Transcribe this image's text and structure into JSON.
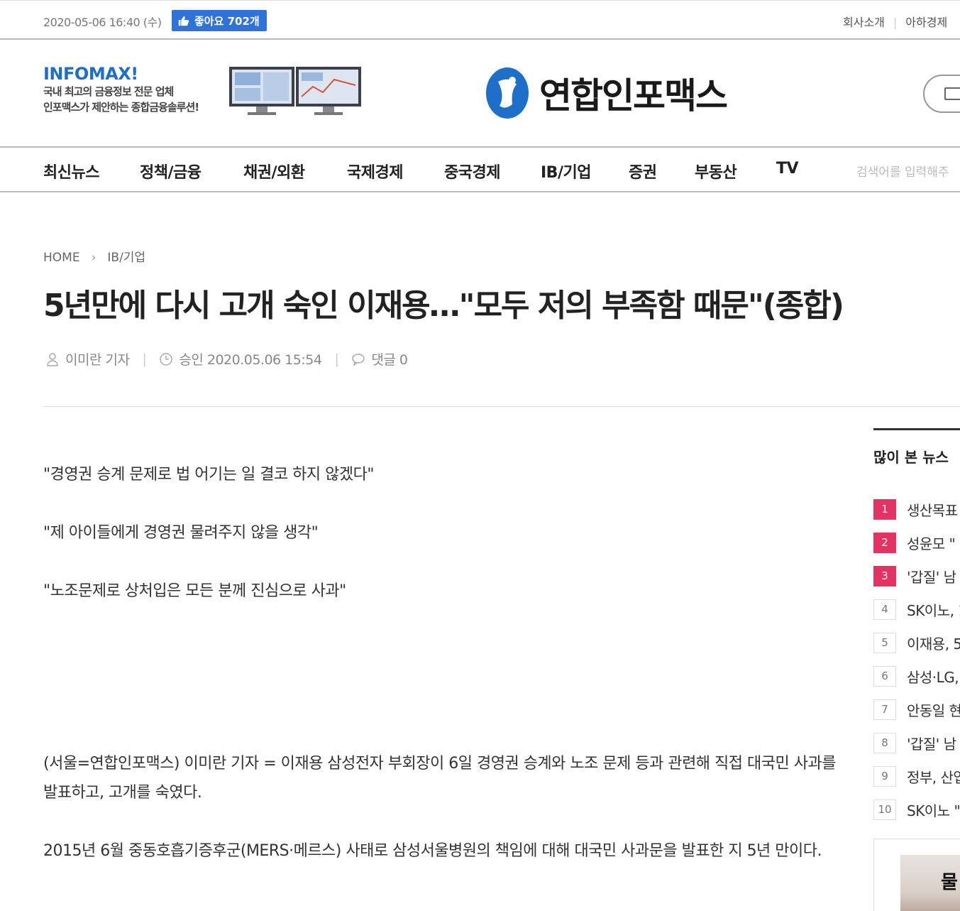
{
  "topbar": {
    "datetime": "2020-05-06 16:40 (수)",
    "like_label": "좋아요 702개",
    "links": [
      "회사소개",
      "아하경제"
    ]
  },
  "ad": {
    "brand": "INFOMAX!",
    "line1": "국내 최고의 금융정보 전문 업체",
    "line2": "인포맥스가 제안하는 종합금융솔루션!"
  },
  "logo": {
    "text": "연합인포맥스"
  },
  "nav": {
    "items": [
      "최신뉴스",
      "정책/금융",
      "채권/외환",
      "국제경제",
      "중국경제",
      "IB/기업",
      "증권",
      "부동산",
      "TV"
    ],
    "search_placeholder": "검색어를 입력해주"
  },
  "article": {
    "breadcrumb": [
      "HOME",
      "IB/기업"
    ],
    "title": "5년만에 다시 고개 숙인 이재용…\"모두 저의 부족함 때문\"(종합)",
    "author": "이미란 기자",
    "approved": "승인 2020.05.06 15:54",
    "comments": "댓글 0",
    "quotes": [
      "\"경영권 승계 문제로 법 어기는 일 결코 하지 않겠다\"",
      "\"제 아이들에게 경영권 물려주지 않을 생각\"",
      "\"노조문제로 상처입은 모든 분께 진심으로 사과\""
    ],
    "paragraphs": [
      "(서울=연합인포맥스) 이미란 기자 = 이재용 삼성전자 부회장이 6일 경영권 승계와 노조 문제 등과 관련해 직접 대국민 사과를 발표하고, 고개를 숙였다.",
      "2015년 6월 중동호흡기증후군(MERS·메르스) 사태로 삼성서울병원의 책임에 대해 대국민 사과문을 발표한 지 5년 만이다."
    ]
  },
  "sidebar": {
    "title": "많이 본 뉴스",
    "ranks": [
      {
        "num": "1",
        "text": "생산목표"
      },
      {
        "num": "2",
        "text": "성윤모 \""
      },
      {
        "num": "3",
        "text": "'갑질' 남"
      },
      {
        "num": "4",
        "text": "SK이노, 1"
      },
      {
        "num": "5",
        "text": "이재용, 5"
      },
      {
        "num": "6",
        "text": "삼성·LG, "
      },
      {
        "num": "7",
        "text": "안동일 현"
      },
      {
        "num": "8",
        "text": "'갑질' 남"
      },
      {
        "num": "9",
        "text": "정부, 산업"
      },
      {
        "num": "10",
        "text": "SK이노 \""
      }
    ],
    "box_text": "물"
  },
  "colors": {
    "accent": "#2f72d8",
    "rank_hot": "#e43263",
    "logo_blue": "#1d6fc9"
  }
}
